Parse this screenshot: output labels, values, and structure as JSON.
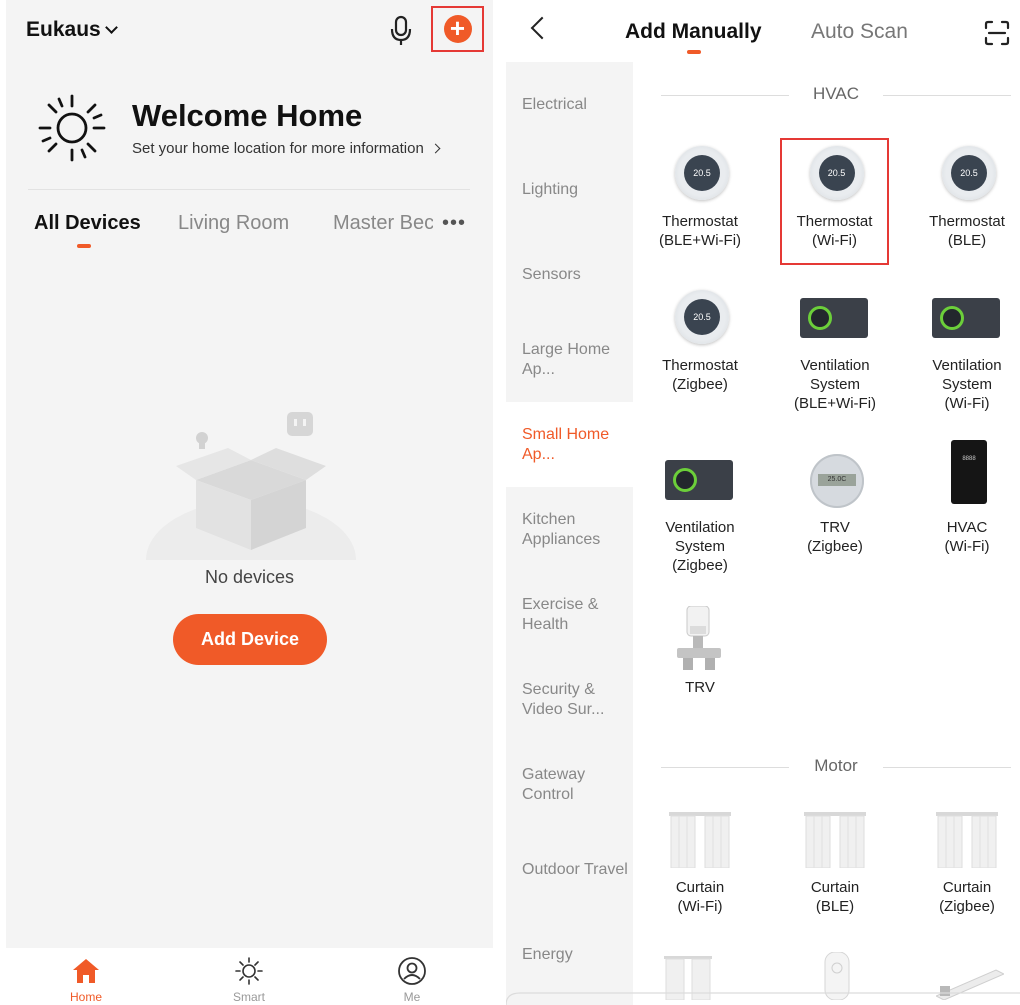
{
  "left": {
    "home_name": "Eukaus",
    "welcome_title": "Welcome Home",
    "welcome_sub": "Set your home location for more information",
    "rooms": [
      "All Devices",
      "Living Room",
      "Master Bec"
    ],
    "more": "•••",
    "empty_text": "No devices",
    "add_device": "Add Device",
    "nav": [
      "Home",
      "Smart",
      "Me"
    ]
  },
  "right": {
    "tabs": {
      "manual": "Add Manually",
      "auto": "Auto Scan"
    },
    "categories": [
      "Electrical",
      "Lighting",
      "Sensors",
      "Large Home Ap...",
      "Small Home Ap...",
      "Kitchen Appliances",
      "Exercise & Health",
      "Security & Video Sur...",
      "Gateway Control",
      "Outdoor Travel",
      "Energy"
    ],
    "active_category": "Small Home Ap...",
    "sections": {
      "hvac": "HVAC",
      "motor": "Motor"
    },
    "devices": {
      "t1_l1": "Thermostat",
      "t1_l2": "(BLE+Wi-Fi)",
      "t2_l1": "Thermostat",
      "t2_l2": "(Wi-Fi)",
      "t3_l1": "Thermostat",
      "t3_l2": "(BLE)",
      "t4_l1": "Thermostat",
      "t4_l2": "(Zigbee)",
      "v1_l1": "Ventilation",
      "v1_l2": "System",
      "v1_l3": "(BLE+Wi-Fi)",
      "v2_l1": "Ventilation",
      "v2_l2": "System",
      "v2_l3": "(Wi-Fi)",
      "v3_l1": "Ventilation",
      "v3_l2": "System",
      "v3_l3": "(Zigbee)",
      "trvz_l1": "TRV",
      "trvz_l2": "(Zigbee)",
      "hvac_l1": "HVAC",
      "hvac_l2": "(Wi-Fi)",
      "trv_l1": "TRV",
      "c1_l1": "Curtain",
      "c1_l2": "(Wi-Fi)",
      "c2_l1": "Curtain",
      "c2_l2": "(BLE)",
      "c3_l1": "Curtain",
      "c3_l2": "(Zigbee)"
    },
    "thermo_value": "20.5",
    "trv_display": "25.0C",
    "hvac_display": "8888"
  },
  "colors": {
    "accent": "#f05a28",
    "highlight": "#e53935"
  }
}
